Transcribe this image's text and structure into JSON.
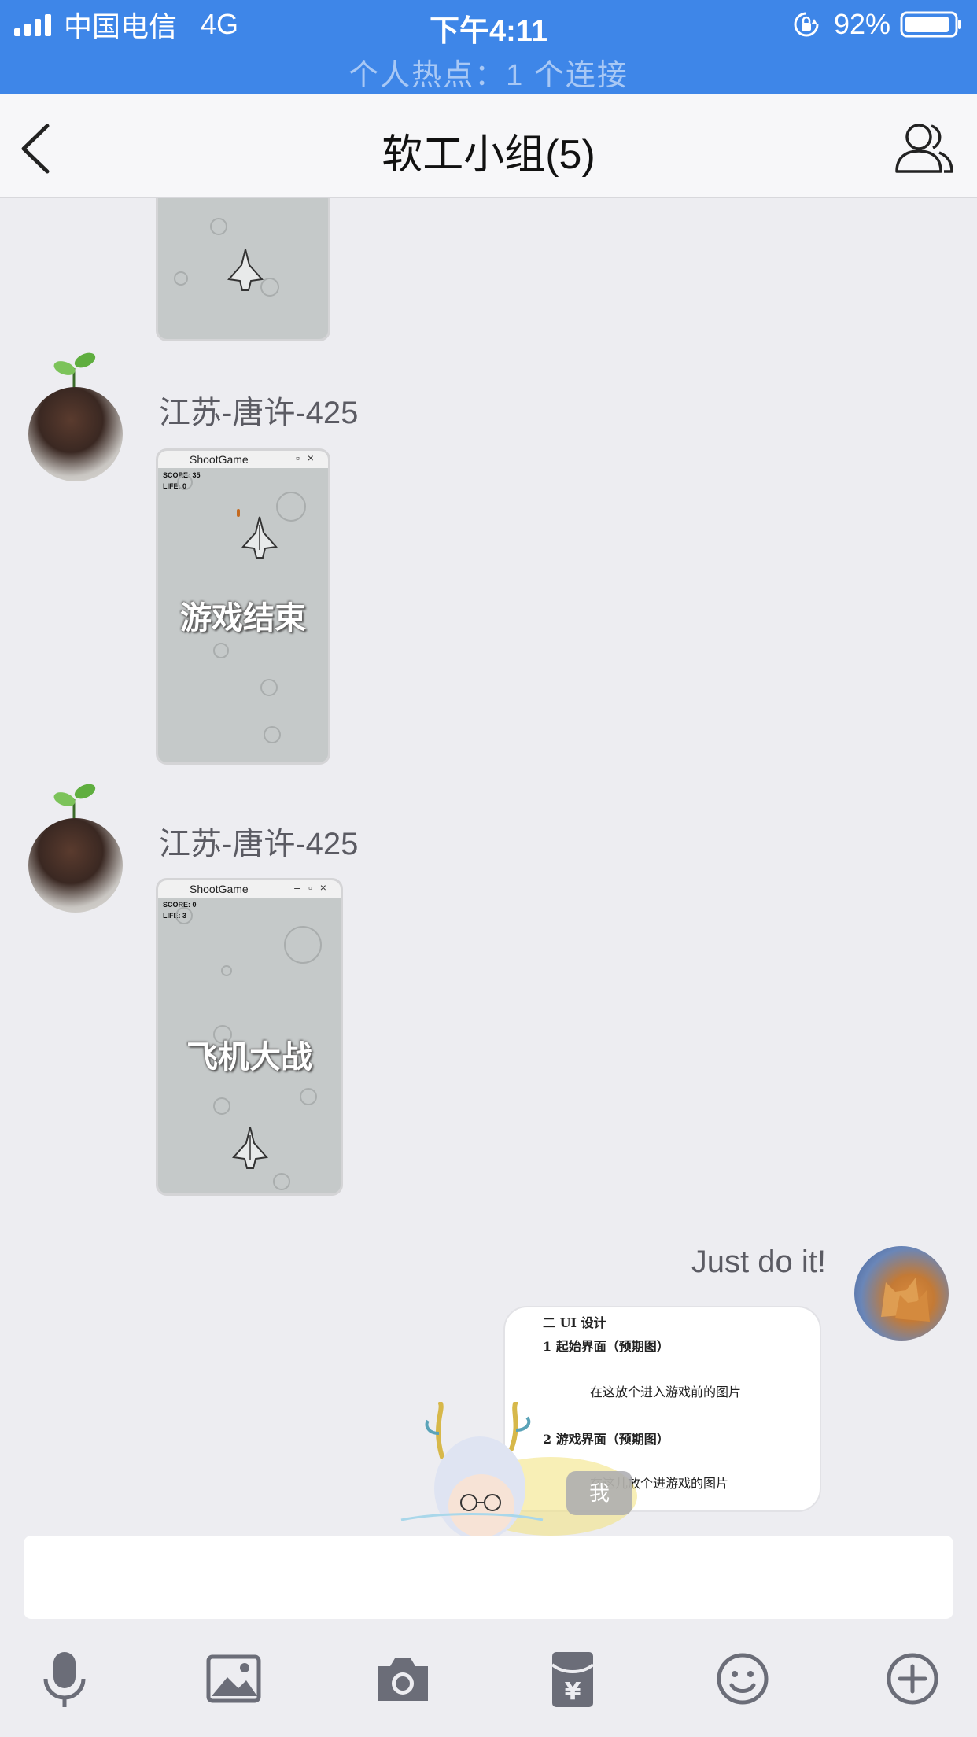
{
  "status_bar": {
    "carrier": "中国电信",
    "network": "4G",
    "time": "下午4:11",
    "battery_percent": "92%",
    "battery_level": 0.92,
    "hotspot_text": "个人热点：1 个连接"
  },
  "nav": {
    "title": "软工小组(5)"
  },
  "messages": [
    {
      "sender": "江苏-唐许-425",
      "image": {
        "window_title": "ShootGame",
        "score": "SCORE: 35",
        "life": "LIFE: 0",
        "overlay_text": "游戏结束"
      }
    },
    {
      "sender": "江苏-唐许-425",
      "image": {
        "window_title": "ShootGame",
        "score": "SCORE: 0",
        "life": "LIFE: 3",
        "overlay_text": "飞机大战"
      }
    }
  ],
  "my_message": {
    "text": "Just do it!",
    "doc_lines": [
      "二 UI 设计",
      "1 起始界面（预期图）",
      "在这放个进入游戏前的图片",
      "2 游戏界面（预期图）",
      "在这儿放个进游戏的图片"
    ],
    "sticker_tag": "我"
  },
  "input": {
    "placeholder": ""
  },
  "toolbar": {
    "icons": [
      "microphone-icon",
      "image-icon",
      "camera-icon",
      "red-packet-icon",
      "emoji-icon",
      "plus-icon"
    ]
  },
  "colors": {
    "status_bar": "#3e86e8",
    "background": "#ededf1",
    "icon_gray": "#6b6d78"
  }
}
